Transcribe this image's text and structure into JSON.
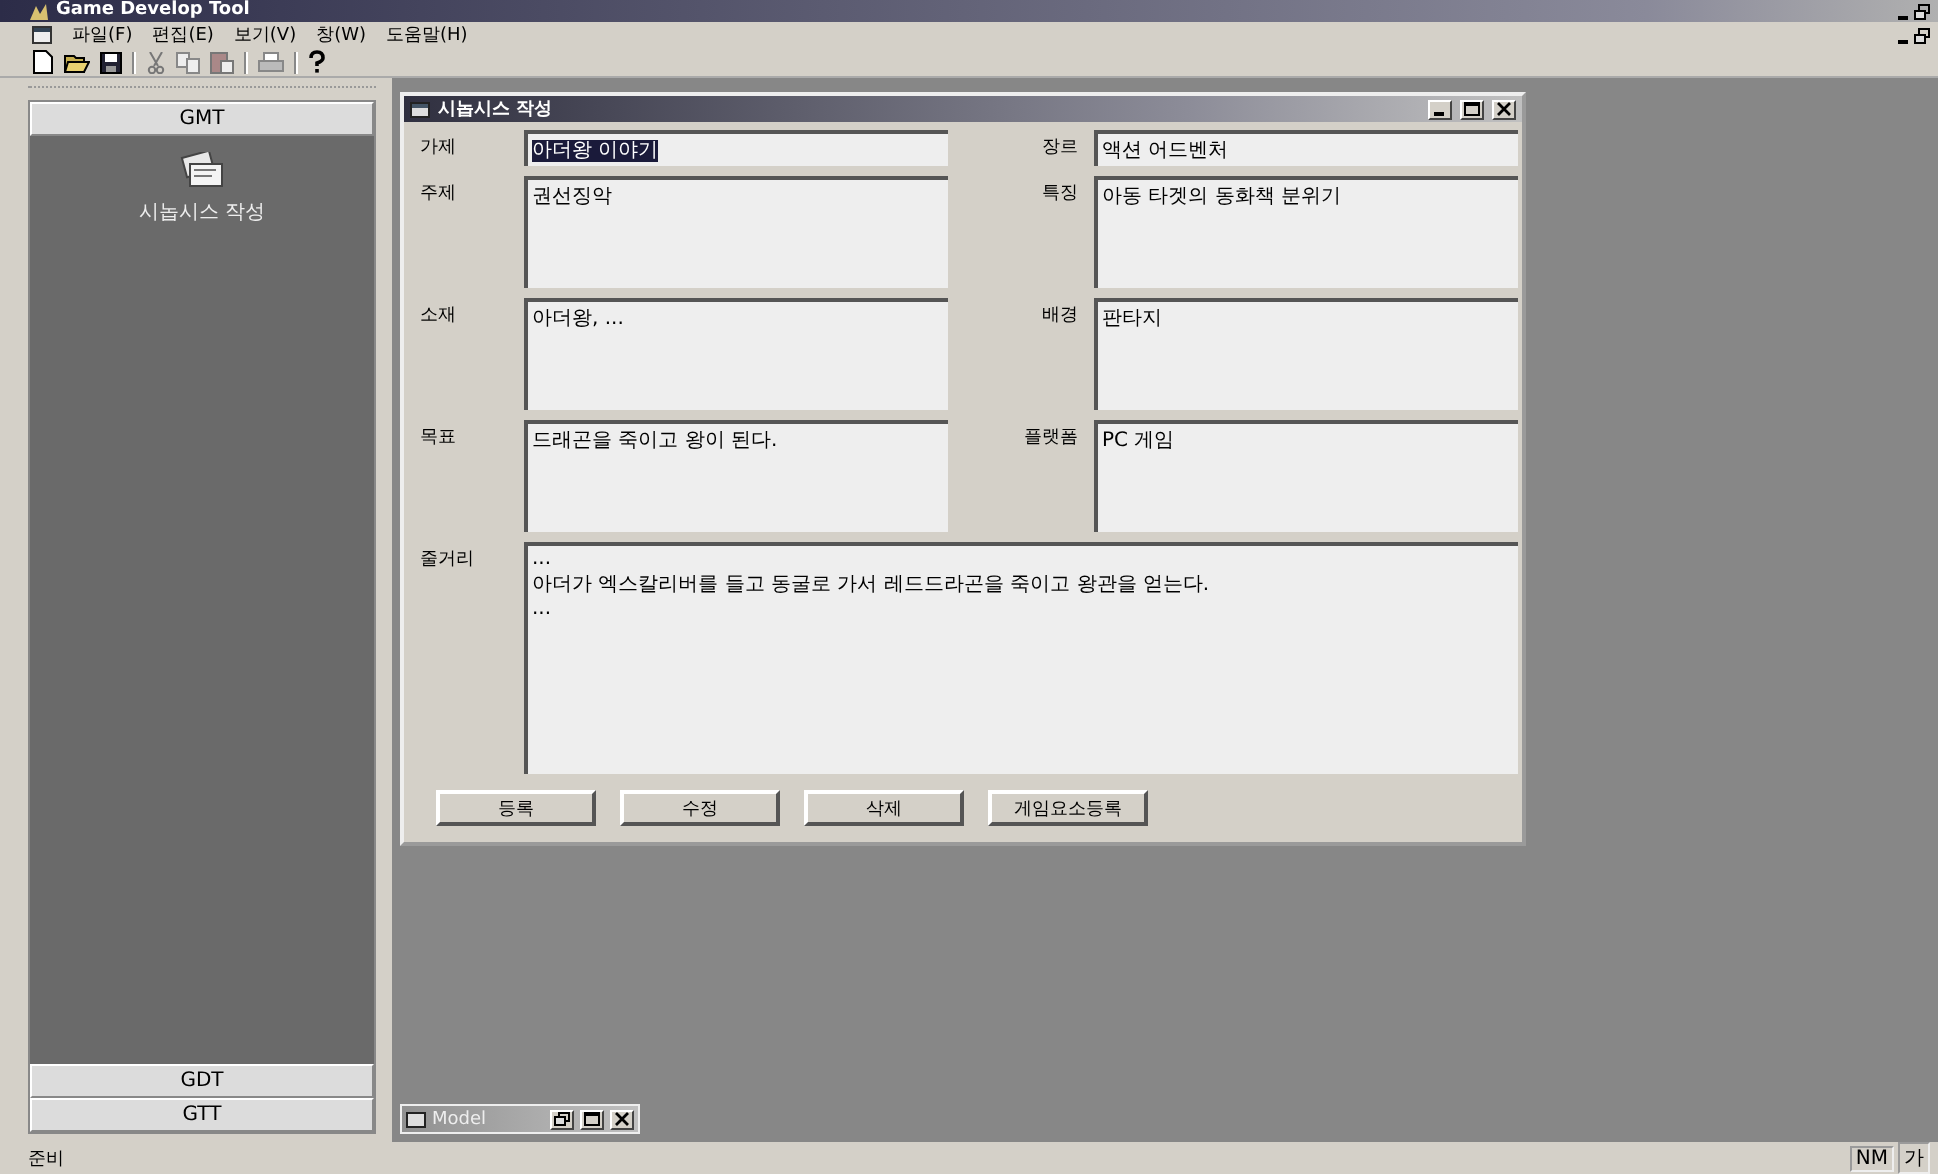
{
  "window": {
    "title": "Game Develop Tool"
  },
  "menu": [
    {
      "label": "파일(F)"
    },
    {
      "label": "편집(E)"
    },
    {
      "label": "보기(V)"
    },
    {
      "label": "창(W)"
    },
    {
      "label": "도움말(H)"
    }
  ],
  "sidebar": {
    "groups": [
      {
        "label": "GMT",
        "expanded": true,
        "items": [
          {
            "label": "시놉시스 작성"
          }
        ]
      },
      {
        "label": "GDT",
        "expanded": false
      },
      {
        "label": "GTT",
        "expanded": false
      }
    ]
  },
  "child_window": {
    "title": "시놉시스 작성",
    "fields": [
      {
        "label": "가제",
        "value": "아더왕 이야기",
        "kind": "line",
        "highlighted": true
      },
      {
        "label": "장르",
        "value": "액션 어드벤처",
        "kind": "line",
        "highlighted": false
      },
      {
        "label": "주제",
        "value": "권선징악",
        "kind": "box",
        "highlighted": false
      },
      {
        "label": "특징",
        "value": "아동 타겟의 동화책 분위기",
        "kind": "box",
        "highlighted": false
      },
      {
        "label": "소재",
        "value": "아더왕, ...",
        "kind": "box",
        "highlighted": false
      },
      {
        "label": "배경",
        "value": "판타지",
        "kind": "box",
        "highlighted": false
      },
      {
        "label": "목표",
        "value": "드래곤을 죽이고 왕이 된다.",
        "kind": "box",
        "highlighted": false
      },
      {
        "label": "플랫폼",
        "value": "PC 게임",
        "kind": "box",
        "highlighted": false
      },
      {
        "label": "줄거리",
        "value": "...\n아더가 엑스칼리버를 들고 동굴로 가서 레드드라곤을 죽이고 왕관을 얻는다.\n...",
        "kind": "wide",
        "highlighted": false
      }
    ],
    "buttons": [
      {
        "label": "등록"
      },
      {
        "label": "수정"
      },
      {
        "label": "삭제"
      },
      {
        "label": "게임요소등록"
      }
    ]
  },
  "minimized_window": {
    "title": "Model"
  },
  "status_bar": {
    "text": "준비",
    "indicators": [
      "NM",
      "가"
    ]
  }
}
